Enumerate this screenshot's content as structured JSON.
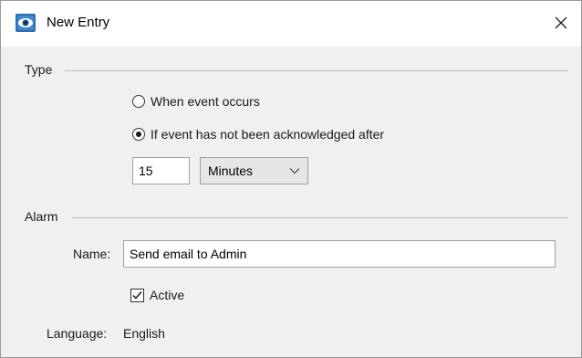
{
  "window": {
    "title": "New Entry",
    "app_icon": "eye-icon",
    "close_icon": "close-icon"
  },
  "type_section": {
    "label": "Type",
    "options": [
      {
        "label": "When event occurs",
        "selected": false
      },
      {
        "label": "If event has not been acknowledged after",
        "selected": true
      }
    ],
    "duration_value": "15",
    "unit_selected": "Minutes"
  },
  "alarm_section": {
    "label": "Alarm",
    "name_label": "Name:",
    "name_value": "Send email to Admin",
    "active_label": "Active",
    "active_checked": true,
    "language_label": "Language:",
    "language_value": "English"
  },
  "colors": {
    "icon_bg": "#2f6fb0",
    "dialog_bg": "#f0f0f0"
  }
}
